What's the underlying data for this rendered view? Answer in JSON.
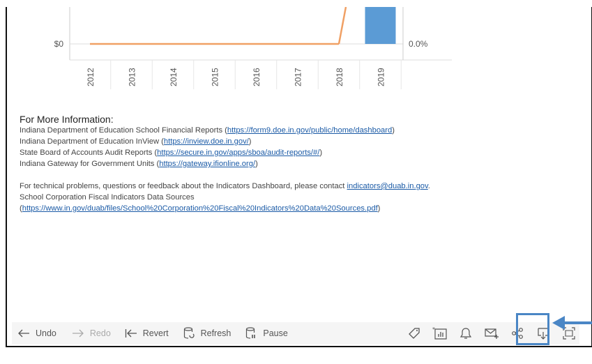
{
  "chart_data": {
    "type": "bar",
    "categories": [
      "2012",
      "2013",
      "2014",
      "2015",
      "2016",
      "2017",
      "2018",
      "2019"
    ],
    "y_left_tick": "$0",
    "y_right_tick": "0.0%",
    "series": [
      {
        "type": "line",
        "values": [
          0,
          0,
          0,
          0,
          0,
          0,
          0,
          null
        ],
        "color": "#f0a064"
      },
      {
        "type": "bar",
        "values": [
          null,
          null,
          null,
          null,
          null,
          null,
          null,
          1
        ],
        "color": "#5b9bd5"
      }
    ]
  },
  "info": {
    "heading": "For More Information:",
    "lines": [
      {
        "prefix": "Indiana Department of Education School Financial Reports (",
        "link": "https://form9.doe.in.gov/public/home/dashboard",
        "suffix": ")"
      },
      {
        "prefix": "Indiana Department of Education InView (",
        "link": "https://inview.doe.in.gov/",
        "suffix": ")"
      },
      {
        "prefix": "State Board of Accounts Audit Reports (",
        "link": "https://secure.in.gov/apps/sboa/audit-reports/#/",
        "suffix": ")"
      },
      {
        "prefix": "Indiana Gateway for Government Units (",
        "link": "https://gateway.ifionline.org/",
        "suffix": ")"
      }
    ],
    "tech": {
      "prefix": "For technical problems, questions or feedback about the Indicators Dashboard, please contact ",
      "link": "indicators@duab.in.gov",
      "suffix": "."
    },
    "sources_title": "School Corporation Fiscal Indicators Data Sources",
    "sources": {
      "prefix": "(",
      "link": "https://www.in.gov/duab/files/School%20Corporation%20Fiscal%20Indicators%20Data%20Sources.pdf",
      "suffix": ")"
    }
  },
  "toolbar": {
    "undo": "Undo",
    "redo": "Redo",
    "revert": "Revert",
    "refresh": "Refresh",
    "pause": "Pause",
    "icons": [
      "tag-icon",
      "view-data-icon",
      "alert-icon",
      "subscribe-icon",
      "share-icon",
      "download-icon",
      "fullscreen-icon"
    ]
  },
  "colors": {
    "highlight": "#4a86c5",
    "link": "#1a5aa6",
    "toolbar_bg": "#f5f5f5"
  }
}
